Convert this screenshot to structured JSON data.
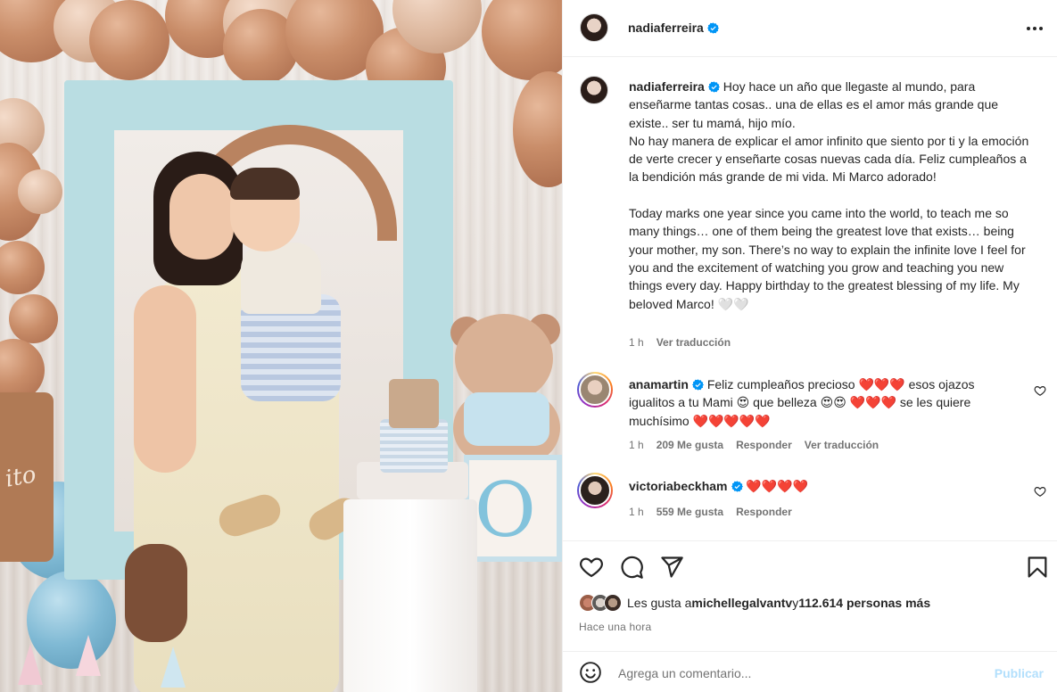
{
  "post": {
    "author": "nadiaferreira",
    "caption_es": "Hoy hace un año que llegaste al mundo, para enseñarme tantas cosas.. una de ellas es el amor más grande que existe.. ser tu mamá, hijo mío.\nNo hay manera de explicar el amor infinito que siento por ti y la emoción de verte crecer y enseñarte cosas nuevas cada día. Feliz cumpleaños a la bendición más grande de mi vida. Mi Marco adorado!",
    "caption_en": "Today marks one year since you came into the world, to teach me so many things… one of them being the greatest love that exists… being your mother, my son. There’s no way to explain the infinite love I feel for you and the excitement of watching you grow and teaching you new things every day. Happy birthday to the greatest blessing of my life. My beloved Marco! 🤍🤍",
    "time": "1 h",
    "translate_label": "Ver traducción",
    "photo_sign_text": "ito"
  },
  "comments": [
    {
      "author": "anamartin",
      "text": "Feliz cumpleaños precioso ❤️❤️❤️ esos ojazos igualitos a tu Mami 😍 que belleza 😍😍 ❤️❤️❤️ se les quiere muchísimo ❤️❤️❤️❤️❤️",
      "time": "1 h",
      "likes": "209 Me gusta",
      "reply": "Responder",
      "translate": "Ver traducción"
    },
    {
      "author": "victoriabeckham",
      "text": "❤️❤️❤️❤️",
      "time": "1 h",
      "likes": "559 Me gusta",
      "reply": "Responder"
    }
  ],
  "likes_summary": {
    "prefix": "Les gusta a ",
    "user": "michellegalvantv",
    "middle": " y ",
    "others": "112.614 personas más"
  },
  "time_ago": "Hace una hora",
  "composer": {
    "placeholder": "Agrega un comentario...",
    "publish": "Publicar"
  },
  "colors": {
    "verified": "#0095f6",
    "heart": "#e0245e",
    "publish_disabled": "#b2dffc",
    "muted_text": "#737373"
  }
}
